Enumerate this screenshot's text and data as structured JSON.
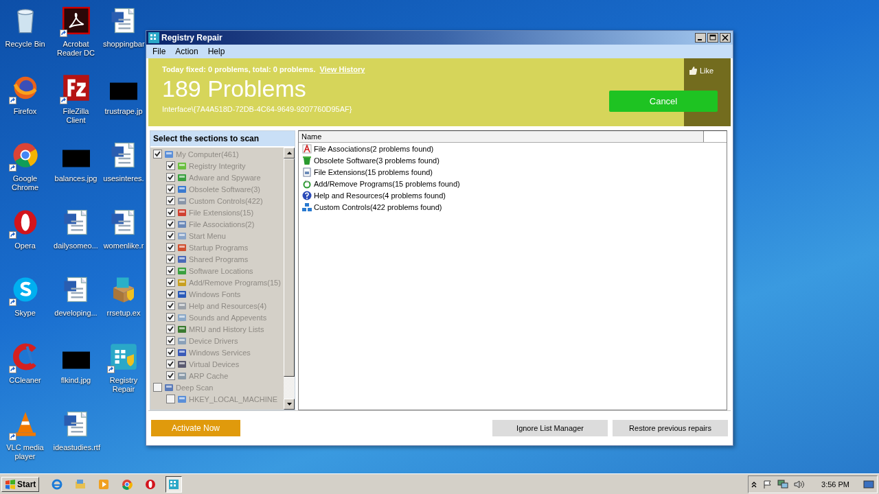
{
  "desktop": {
    "icons": [
      {
        "label": "Recycle Bin",
        "shortcut": false
      },
      {
        "label": "Firefox",
        "shortcut": true
      },
      {
        "label": "Google Chrome",
        "shortcut": true
      },
      {
        "label": "Opera",
        "shortcut": true
      },
      {
        "label": "Skype",
        "shortcut": true
      },
      {
        "label": "CCleaner",
        "shortcut": true
      },
      {
        "label": "VLC media player",
        "shortcut": true
      },
      {
        "label": "Acrobat Reader DC",
        "shortcut": true
      },
      {
        "label": "FileZilla Client",
        "shortcut": true
      },
      {
        "label": "balances.jpg",
        "shortcut": false
      },
      {
        "label": "dailysomeo...",
        "shortcut": false
      },
      {
        "label": "developing...",
        "shortcut": false
      },
      {
        "label": "flkind.jpg",
        "shortcut": false
      },
      {
        "label": "ideastudies.rtf",
        "shortcut": false
      },
      {
        "label": "shoppingbar",
        "shortcut": false
      },
      {
        "label": "trustrape.jp",
        "shortcut": false
      },
      {
        "label": "usesinteres.",
        "shortcut": false
      },
      {
        "label": "womenlike.r",
        "shortcut": false
      },
      {
        "label": "rrsetup.ex",
        "shortcut": false
      },
      {
        "label": "Registry Repair",
        "shortcut": true
      }
    ]
  },
  "window": {
    "title": "Registry Repair",
    "menu": [
      "File",
      "Action",
      "Help"
    ],
    "banner": {
      "summary": "Today fixed: 0 problems, total: 0 problems.",
      "history_link": "View History",
      "headline": "189 Problems",
      "current_key": "Interface\\{7A4A518D-72DB-4C64-9649-9207760D95AF}",
      "like": "Like",
      "cancel": "Cancel"
    },
    "sections": {
      "title": "Select the sections to scan",
      "disabled": true,
      "items": [
        {
          "label": "My Computer(461)",
          "checked": true,
          "children": [
            {
              "label": "Registry Integrity",
              "checked": true
            },
            {
              "label": "Adware and Spyware",
              "checked": true
            },
            {
              "label": "Obsolete Software(3)",
              "checked": true
            },
            {
              "label": "Custom Controls(422)",
              "checked": true
            },
            {
              "label": "File Extensions(15)",
              "checked": true
            },
            {
              "label": "File Associations(2)",
              "checked": true
            },
            {
              "label": "Start Menu",
              "checked": true
            },
            {
              "label": "Startup Programs",
              "checked": true
            },
            {
              "label": "Shared Programs",
              "checked": true
            },
            {
              "label": "Software Locations",
              "checked": true
            },
            {
              "label": "Add/Remove Programs(15)",
              "checked": true
            },
            {
              "label": "Windows Fonts",
              "checked": true
            },
            {
              "label": "Help and Resources(4)",
              "checked": true
            },
            {
              "label": "Sounds and Appevents",
              "checked": true
            },
            {
              "label": "MRU and History Lists",
              "checked": true
            },
            {
              "label": "Device Drivers",
              "checked": true
            },
            {
              "label": "Windows Services",
              "checked": true
            },
            {
              "label": "Virtual Devices",
              "checked": true
            },
            {
              "label": "ARP Cache",
              "checked": true
            }
          ]
        },
        {
          "label": "Deep Scan",
          "checked": false,
          "children": [
            {
              "label": "HKEY_LOCAL_MACHINE",
              "checked": false
            }
          ]
        }
      ]
    },
    "results": {
      "columns": [
        "Name"
      ],
      "rows": [
        "File Associations(2 problems found)",
        "Obsolete Software(3 problems found)",
        "File Extensions(15 problems found)",
        "Add/Remove Programs(15 problems found)",
        "Help and Resources(4 problems found)",
        "Custom Controls(422 problems found)"
      ]
    },
    "footer": {
      "activate": "Activate Now",
      "buttons": [
        "Ignore List Manager",
        "Restore previous repairs"
      ]
    }
  },
  "taskbar": {
    "start": "Start",
    "pinned": [
      {
        "active": false
      },
      {
        "active": false
      },
      {
        "active": false
      },
      {
        "active": false
      },
      {
        "active": false
      },
      {
        "active": true
      }
    ],
    "clock": "3:56 PM"
  }
}
